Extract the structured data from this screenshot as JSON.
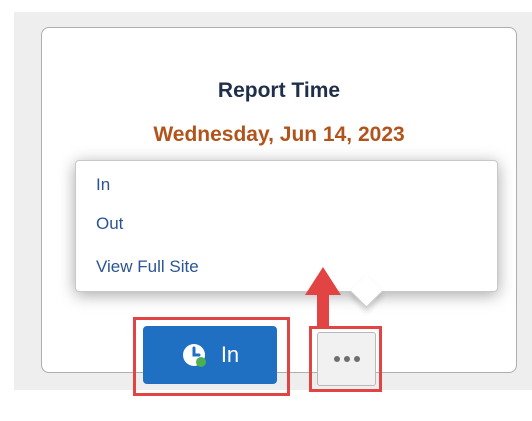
{
  "card": {
    "title": "Report Time",
    "date": "Wednesday, Jun 14, 2023"
  },
  "menu": {
    "items": [
      {
        "label": "In"
      },
      {
        "label": "Out"
      },
      {
        "label": "View Full Site"
      }
    ]
  },
  "buttons": {
    "in_label": "In",
    "in_icon": "clock-icon",
    "more_icon": "ellipsis-icon"
  },
  "colors": {
    "accent": "#1f6fc3",
    "date": "#b1541c",
    "highlight": "#e24343",
    "menu_text": "#2b5494"
  }
}
